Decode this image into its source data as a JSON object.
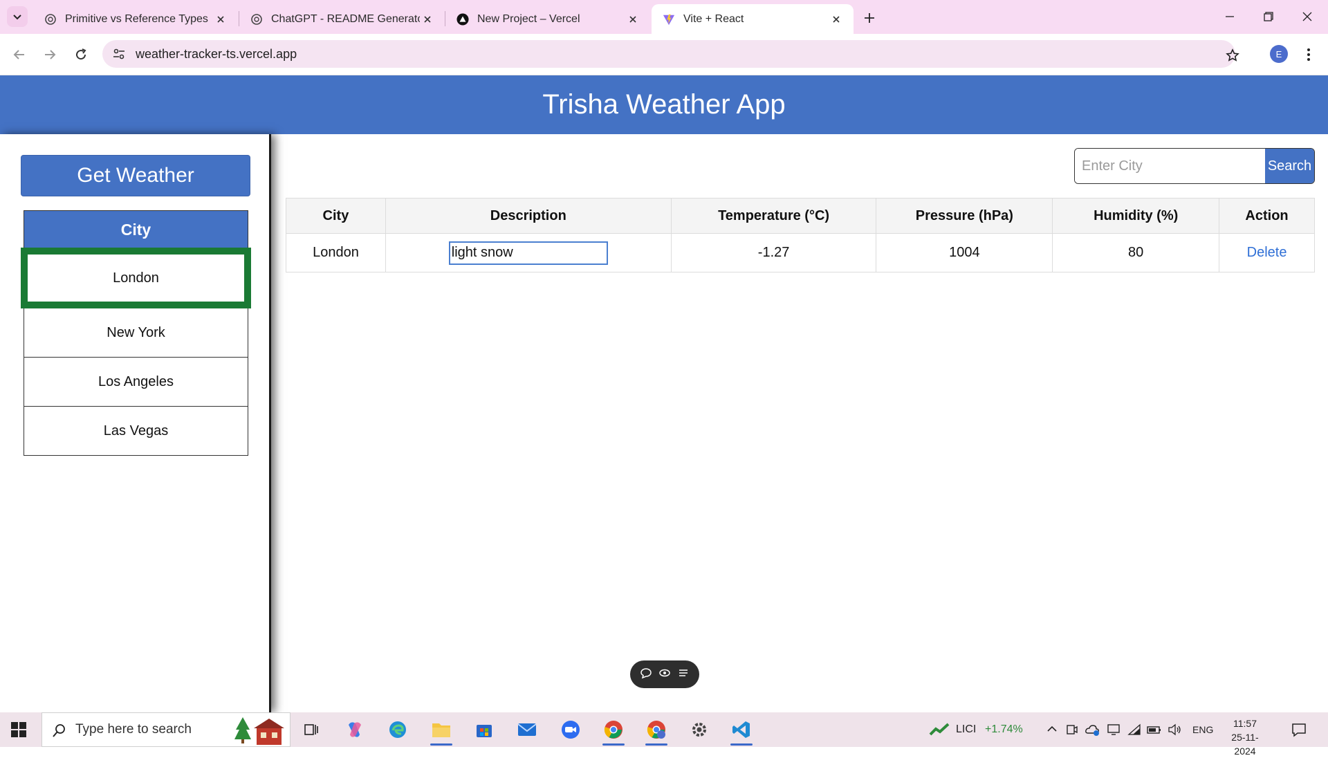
{
  "browser": {
    "tabs": [
      {
        "title": "Primitive vs Reference Types",
        "icon": "chatgpt-icon"
      },
      {
        "title": "ChatGPT - README Generator",
        "icon": "chatgpt-icon"
      },
      {
        "title": "New Project – Vercel",
        "icon": "vercel-icon"
      },
      {
        "title": "Vite + React",
        "icon": "vite-icon",
        "active": true
      }
    ],
    "url": "weather-tracker-ts.vercel.app",
    "profile_initial": "E"
  },
  "app": {
    "title": "Trisha Weather App",
    "get_weather_label": "Get Weather",
    "city_header": "City",
    "cities": [
      "London",
      "New York",
      "Los Angeles",
      "Las Vegas"
    ],
    "selected_city": "London",
    "search": {
      "placeholder": "Enter City",
      "button_label": "Search"
    },
    "table": {
      "headers": [
        "City",
        "Description",
        "Temperature (°C)",
        "Pressure (hPa)",
        "Humidity (%)",
        "Action"
      ],
      "rows": [
        {
          "city": "London",
          "description": "light snow",
          "temperature": "-1.27",
          "pressure": "1004",
          "humidity": "80",
          "action": "Delete"
        }
      ]
    }
  },
  "taskbar": {
    "search_placeholder": "Type here to search",
    "stock_ticker": "LICI",
    "stock_change": "+1.74%",
    "language": "ENG",
    "time": "11:57",
    "date": "25-11-2024"
  },
  "colors": {
    "app_blue": "#4472c4",
    "selected_border": "#1a7a34",
    "tabbar_bg": "#f8dcf3",
    "stock_green": "#2e8b3a"
  }
}
